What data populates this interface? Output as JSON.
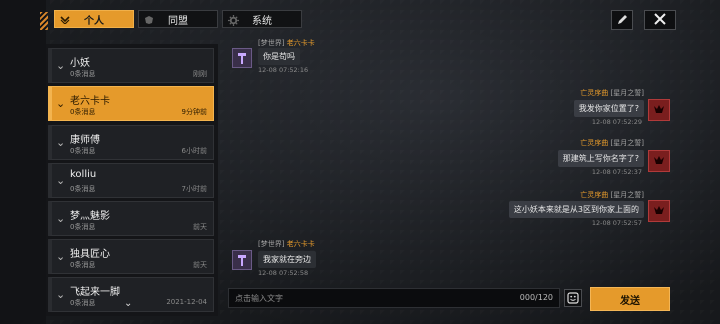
{
  "tabs": [
    {
      "label": "个人",
      "icon": "chevron-down-icon",
      "active": true
    },
    {
      "label": "同盟",
      "icon": "alliance-icon",
      "active": false
    },
    {
      "label": "系统",
      "icon": "gear-icon",
      "active": false
    }
  ],
  "conversations": [
    {
      "name": "小妖",
      "sub": "0条消息",
      "time": "刚刚",
      "active": false
    },
    {
      "name": "老六卡卡",
      "sub": "0条消息",
      "time": "9分钟前",
      "active": true
    },
    {
      "name": "康师傅",
      "sub": "0条消息",
      "time": "6小时前",
      "active": false
    },
    {
      "name": "kolliu",
      "sub": "0条消息",
      "time": "7小时前",
      "active": false
    },
    {
      "name": "梦灬魅影",
      "sub": "0条消息",
      "time": "前天",
      "active": false
    },
    {
      "name": "独具匠心",
      "sub": "0条消息",
      "time": "前天",
      "active": false
    },
    {
      "name": "飞起来一脚",
      "sub": "0条消息",
      "time": "2021-12-04",
      "active": false
    }
  ],
  "messages": [
    {
      "side": "left",
      "sender_tag": "[梦世界]",
      "sender_name": "老六卡卡",
      "text": "你是苟吗",
      "time": "12-08 07:52:16"
    },
    {
      "side": "right",
      "sender_name": "亡灵序曲",
      "sender_tag": "[星月之誓]",
      "text": "我发你家位置了?",
      "time": "12-08 07:52:29"
    },
    {
      "side": "right",
      "sender_name": "亡灵序曲",
      "sender_tag": "[星月之誓]",
      "text": "那建筑上写你名字了?",
      "time": "12-08 07:52:37"
    },
    {
      "side": "right",
      "sender_name": "亡灵序曲",
      "sender_tag": "[星月之誓]",
      "text": "这小妖本来就是从3区到你家上面的",
      "time": "12-08 07:52:57"
    },
    {
      "side": "left",
      "sender_tag": "[梦世界]",
      "sender_name": "老六卡卡",
      "text": "我家就在旁边",
      "time": "12-08 07:52:58"
    }
  ],
  "input": {
    "placeholder": "点击输入文字",
    "count": "000/120"
  },
  "send_label": "发送",
  "colors": {
    "accent": "#e59a2b",
    "background": "#1a1c20",
    "enemy_avatar": "#7a1e1e"
  }
}
